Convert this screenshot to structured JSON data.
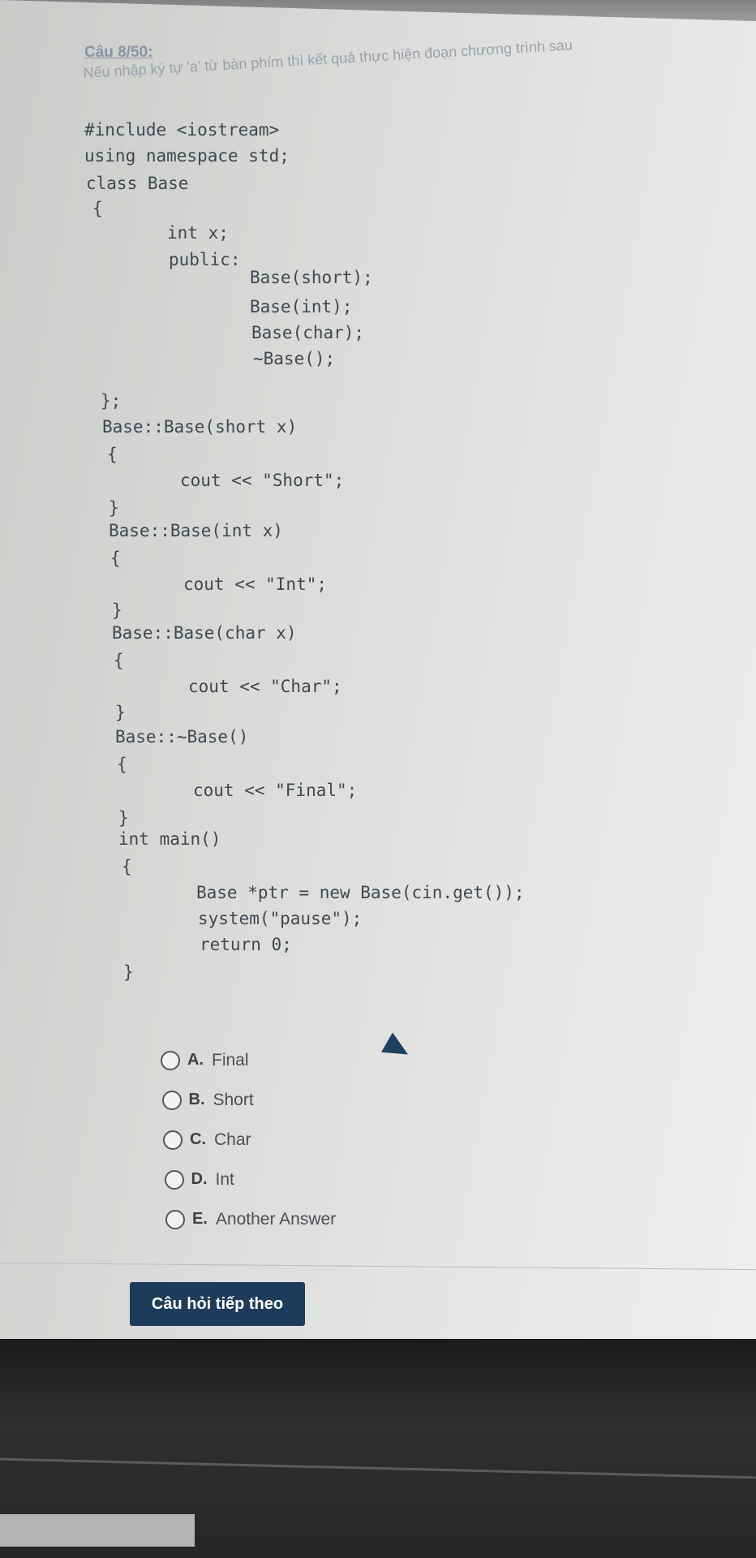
{
  "question": {
    "title": "Câu 8/50:",
    "prompt": "Nếu nhập ký tự 'a' từ bàn phím thì kết quả thực hiện đoạn chương trình sau"
  },
  "code_lines": [
    "#include <iostream>",
    "using namespace std;",
    "class Base",
    "{",
    "int x;",
    "public:",
    "Base(short);",
    "Base(int);",
    "Base(char);",
    "~Base();",
    "};",
    "Base::Base(short x)",
    "{",
    "cout << \"Short\";",
    "}",
    "Base::Base(int x)",
    "{",
    "cout << \"Int\";",
    "}",
    "Base::Base(char x)",
    "{",
    "cout << \"Char\";",
    "}",
    "Base::~Base()",
    "{",
    "cout << \"Final\";",
    "}",
    "int main()",
    "{",
    "Base *ptr = new Base(cin.get());",
    "system(\"pause\");",
    "return 0;",
    "}"
  ],
  "options": [
    {
      "letter": "A.",
      "text": "Final"
    },
    {
      "letter": "B.",
      "text": "Short"
    },
    {
      "letter": "C.",
      "text": "Char"
    },
    {
      "letter": "D.",
      "text": "Int"
    },
    {
      "letter": "E.",
      "text": "Another Answer"
    }
  ],
  "next_button": "Câu hỏi tiếp theo",
  "colors": {
    "button_bg": "#1d3c5a",
    "code_text": "#404752",
    "title_text": "#8d93a3"
  },
  "icons": {
    "cursor": "mouse-pointer-icon",
    "radio": "radio-circle-icon"
  }
}
